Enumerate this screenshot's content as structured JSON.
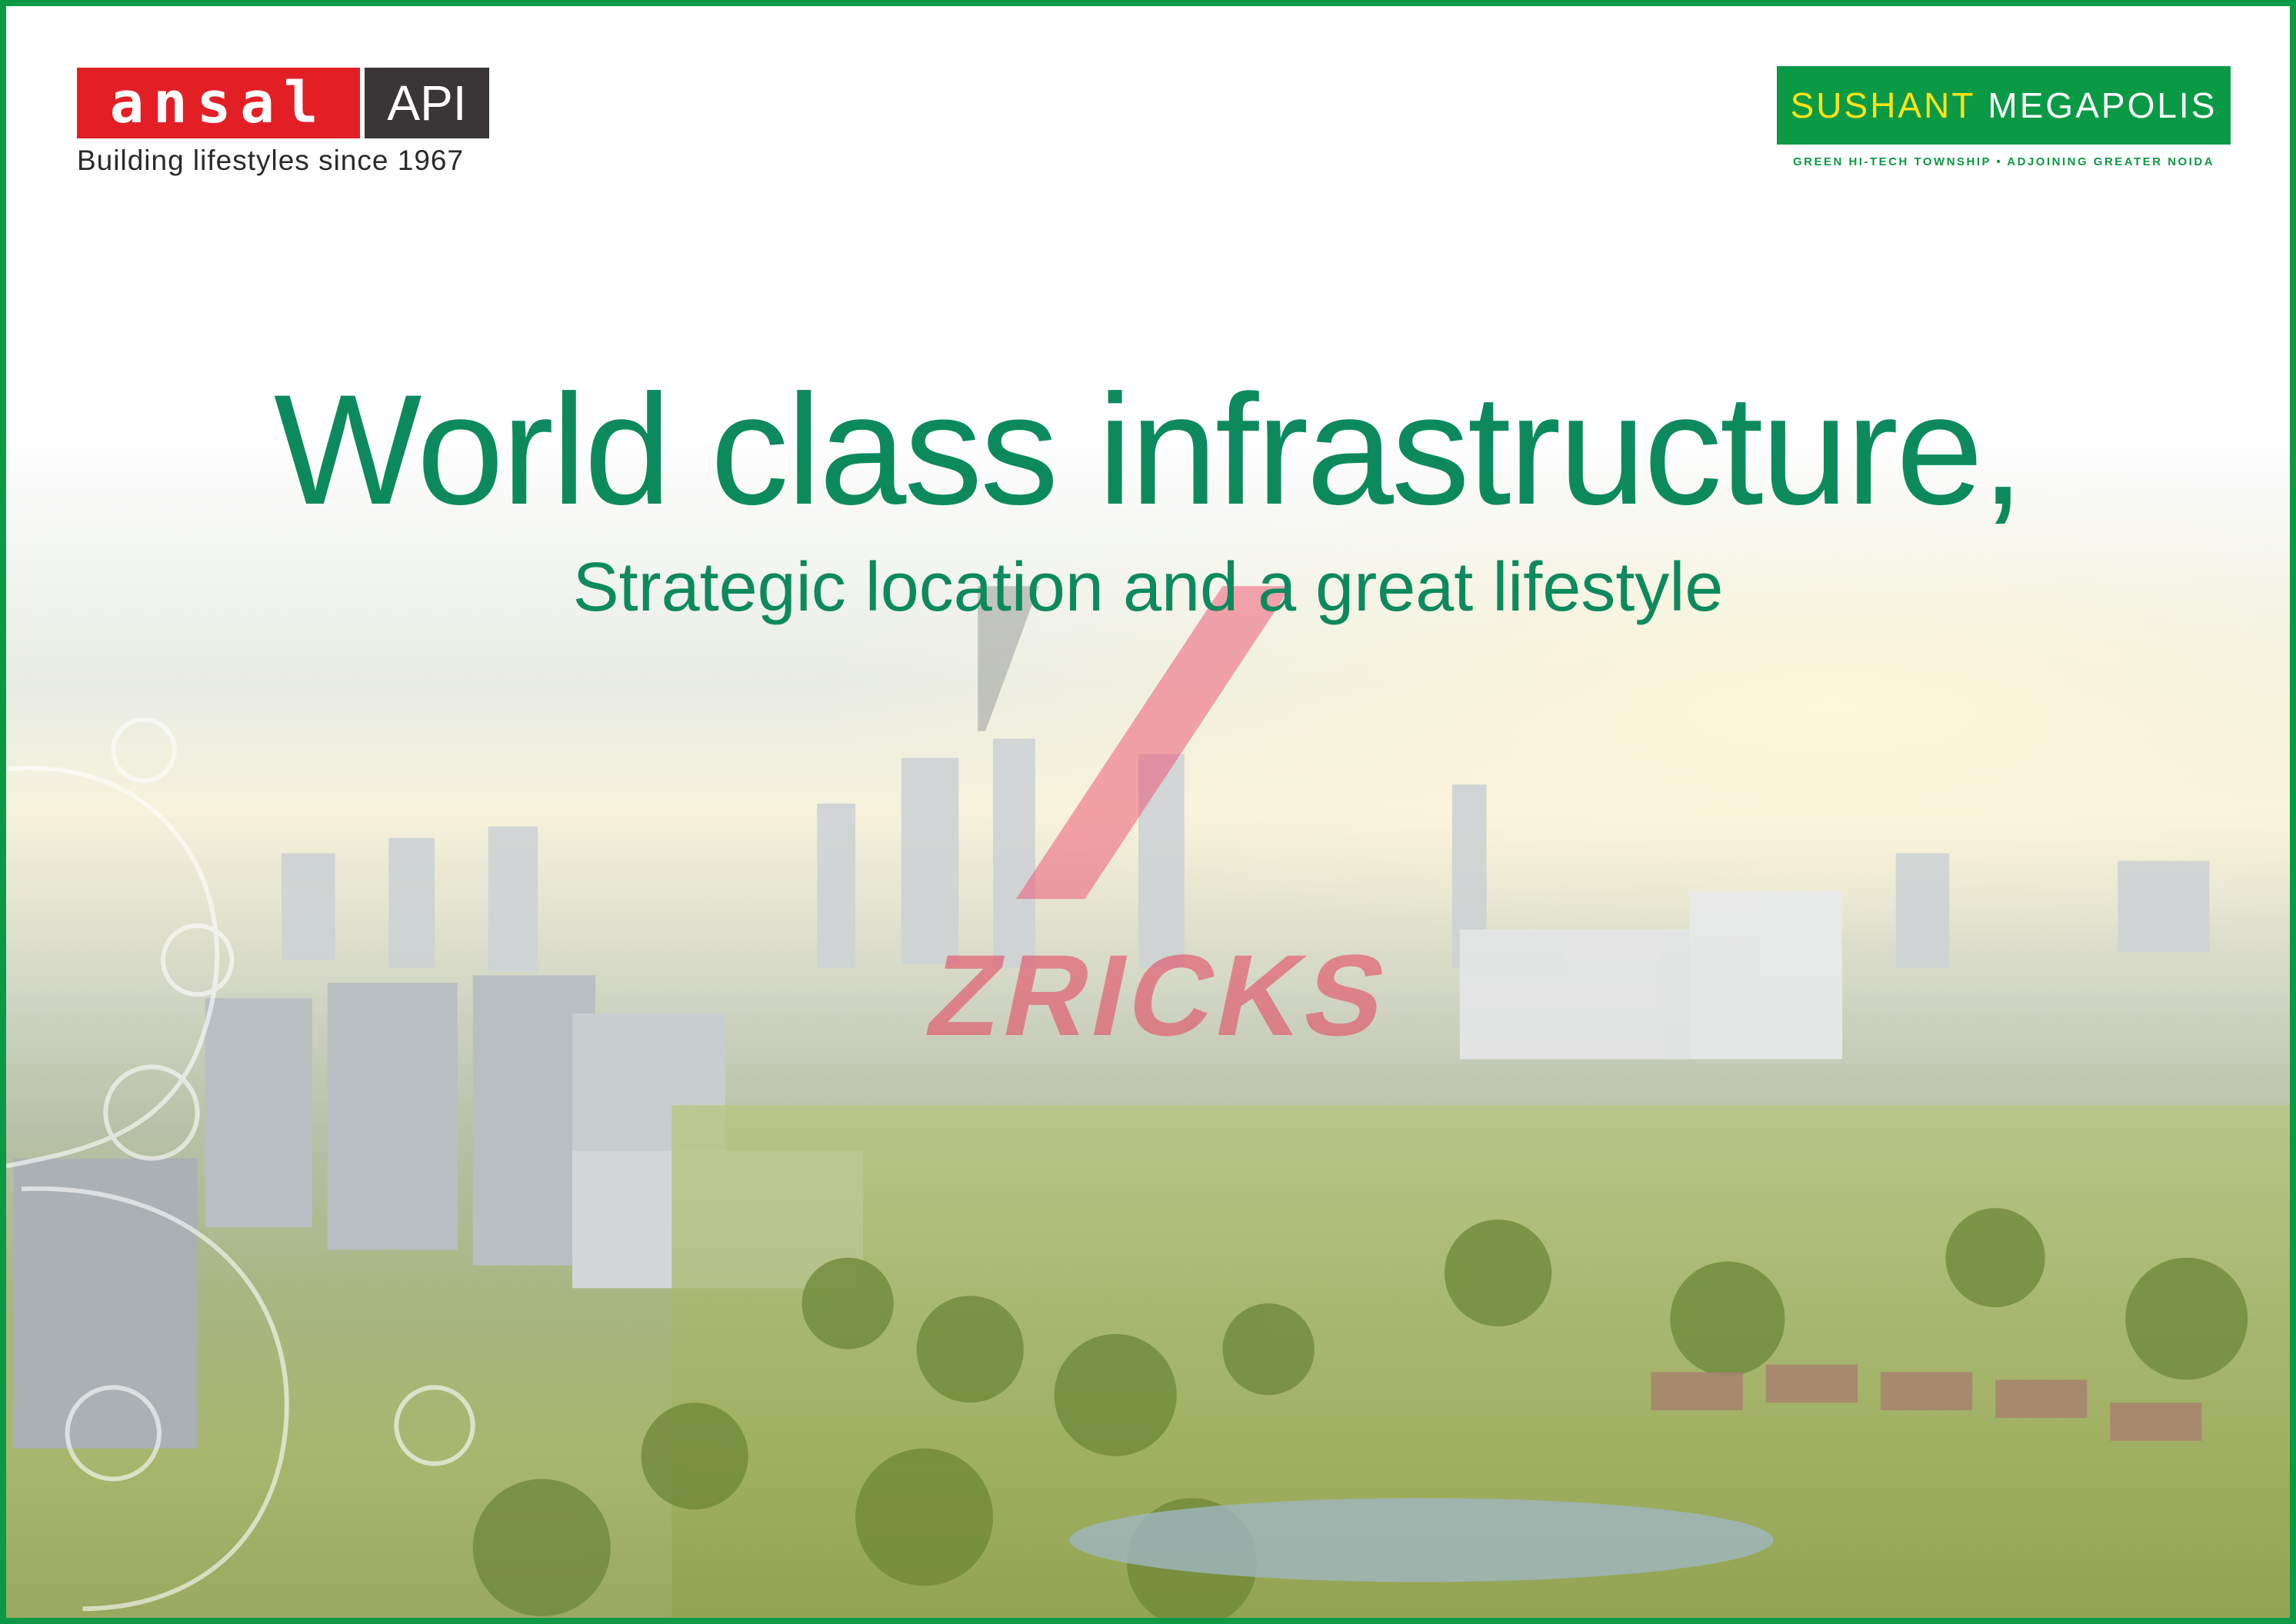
{
  "ansal": {
    "logo_red": "ansal",
    "logo_dark": "API",
    "tagline": "Building lifestyles since 1967"
  },
  "sushant": {
    "name_yellow": "SUSHANT",
    "name_white": "MEGAPOLIS",
    "tagline": "GREEN HI-TECH TOWNSHIP • ADJOINING GREATER NOIDA"
  },
  "headline": "World class infrastructure,",
  "subheadline": "Strategic location and a great lifestyle",
  "watermark": "ZRICKS",
  "colors": {
    "brand_green": "#0a9a45",
    "text_green": "#0d8a5d",
    "ansal_red": "#e31f26",
    "ansal_dark": "#3a3537",
    "sushant_yellow": "#ffe21a"
  }
}
